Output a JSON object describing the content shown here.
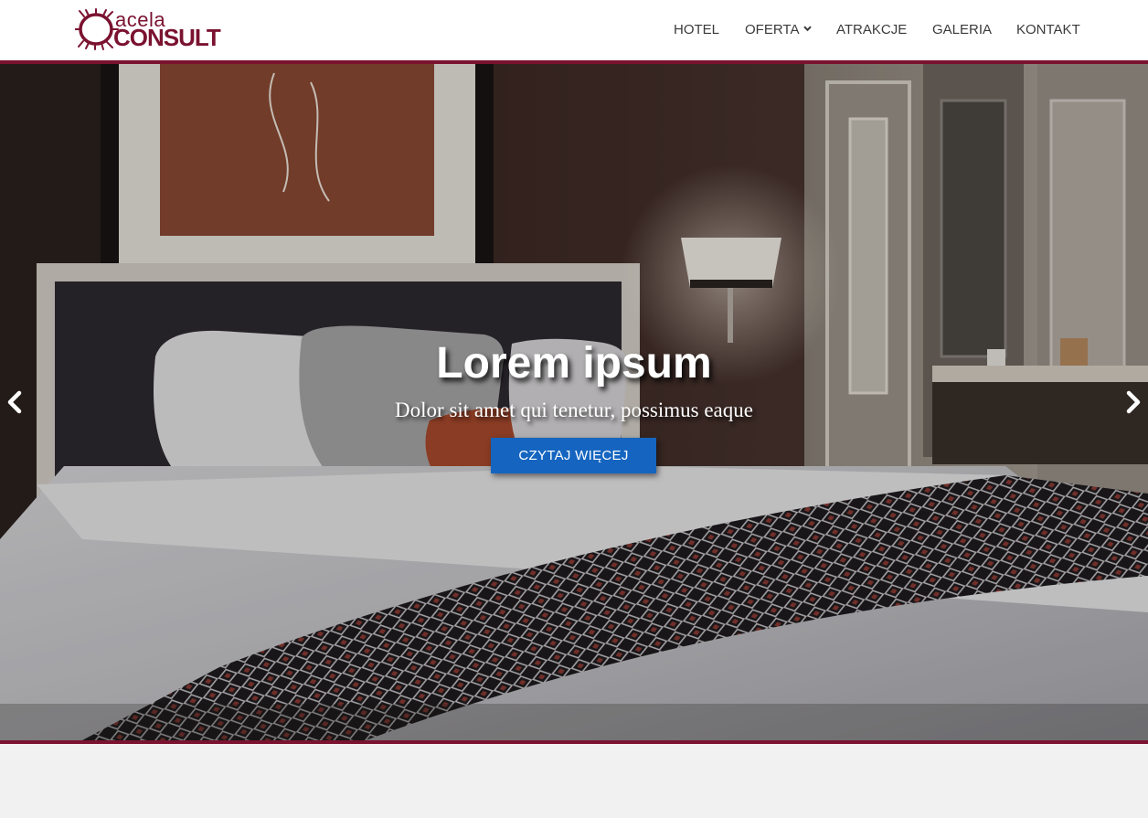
{
  "logo": {
    "top_text": "acela",
    "bottom_text": "CONSULT",
    "icon": "thorn-wreath-icon"
  },
  "nav": {
    "items": [
      {
        "label": "HOTEL"
      },
      {
        "label": "OFERTA",
        "icon": "chevron-down-icon"
      },
      {
        "label": "ATRAKCJE"
      },
      {
        "label": "GALERIA"
      },
      {
        "label": "KONTAKT"
      }
    ]
  },
  "hero": {
    "title": "Lorem ipsum",
    "subtitle": "Dolor sit amet qui tenetur, possimus eaque",
    "button_label": "CZYTAJ WIĘCEJ",
    "prev_icon": "chevron-left-icon",
    "next_icon": "chevron-right-icon"
  },
  "colors": {
    "brand": "#7a1230",
    "button": "#1565c0",
    "page_background": "#f1f1f1"
  }
}
